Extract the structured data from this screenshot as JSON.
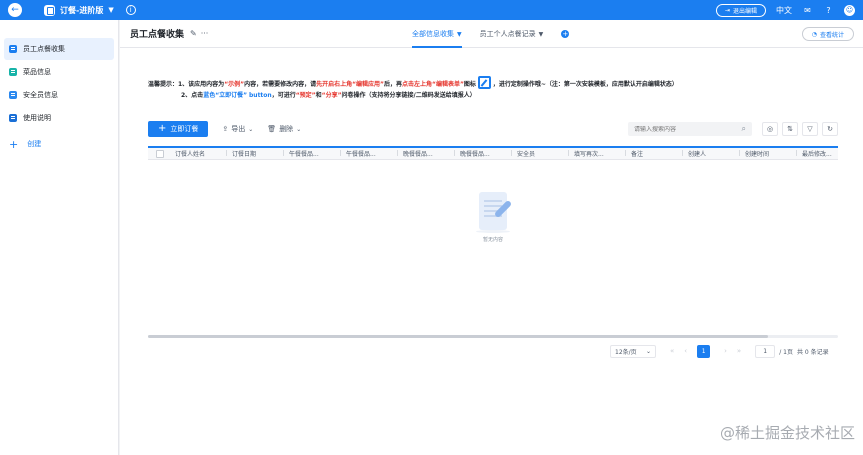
{
  "topbar": {
    "back_icon": "arrow-left-icon",
    "app_title": "订餐-进阶版",
    "exit_edit_label": "退出编辑",
    "lang_label": "中文",
    "accent_color": "#1b7ef0"
  },
  "sidebar": {
    "items": [
      {
        "label": "员工点餐收集",
        "active": true
      },
      {
        "label": "菜品信息",
        "active": false
      },
      {
        "label": "安全员信息",
        "active": false
      },
      {
        "label": "使用说明",
        "active": false
      }
    ],
    "create_label": "创建"
  },
  "header": {
    "title": "员工点餐收集",
    "more_label": "···",
    "tabs": [
      {
        "label": "全部信息收集",
        "active": true
      },
      {
        "label": "员工个人点餐记录",
        "active": false
      }
    ],
    "add_tab_label": "+",
    "stats_label": "查看统计"
  },
  "notice": {
    "line1": {
      "p1": "温馨提示：1、该应用内容为",
      "p2": "“示例”",
      "p3": "内容，若需要修改内容，请",
      "p4": "先开启右上角“编辑应用”",
      "p5": "后，再",
      "p6": "点击左上角“编辑表单”",
      "p7": "图标",
      "p8": "，进行定制操作哦~（注：第一次安装模板，应用默认开启编辑状态）"
    },
    "line2": {
      "p1": "2、点击",
      "p2": "蓝色“立即订餐”",
      "p3": "button",
      "p4": "，可进行",
      "p5": "“预定”",
      "p6": "和",
      "p7": "“分享”",
      "p8": "问卷操作（支持将分享链接/二维码发送给填报人）"
    }
  },
  "toolbar": {
    "order_label": "立即订餐",
    "export_label": "导出",
    "delete_label": "删除",
    "search_placeholder": "请输入搜索内容"
  },
  "table": {
    "columns": [
      "订餐人姓名",
      "订餐日期",
      "午餐餐品...",
      "午餐餐品...",
      "晚餐餐品...",
      "晚餐餐品...",
      "安全员",
      "填写再次...",
      "备注",
      "创建人",
      "创建时间",
      "最后修改..."
    ],
    "empty_text": "暂无内容"
  },
  "pagination": {
    "page_size": "12条/页",
    "current_page": "1",
    "page_input": "1",
    "total_pages": "/ 1页",
    "total_count": "共 0 条记录"
  },
  "watermark": "@稀土掘金技术社区"
}
